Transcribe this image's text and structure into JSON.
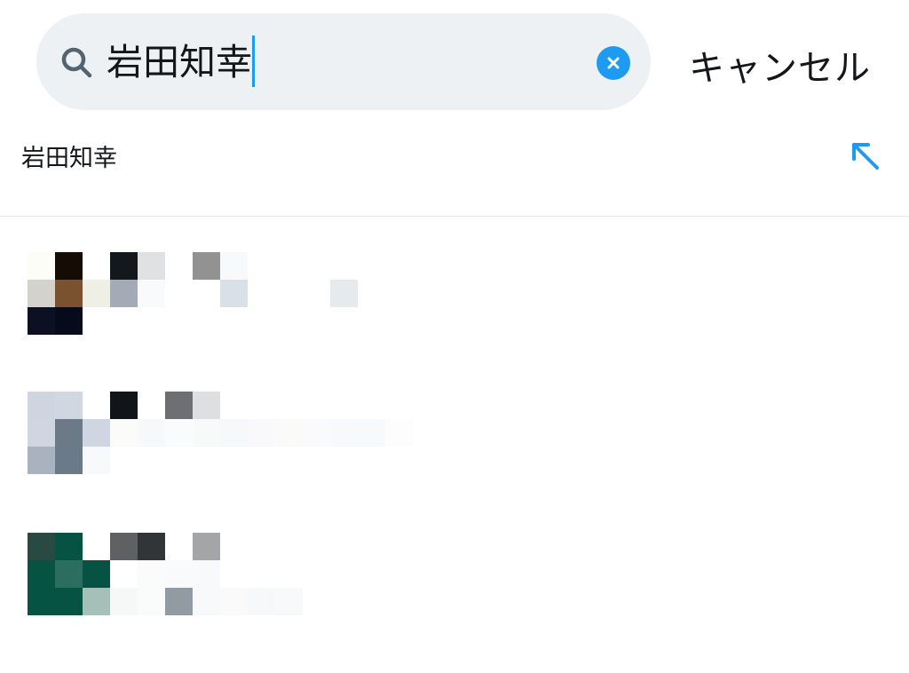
{
  "search": {
    "query": "岩田知幸",
    "icon": "search-icon",
    "clear_icon": "clear-icon"
  },
  "cancel_label": "キャンセル",
  "suggestion": {
    "text": "岩田知幸",
    "icon": "fill-query-arrow-icon"
  },
  "results": [
    {
      "pixels": [
        [
          "#fdfdf8",
          0,
          0
        ],
        [
          "#160c06",
          1,
          0
        ],
        [
          "#14171c",
          3,
          0
        ],
        [
          "#e0e1e3",
          4,
          0
        ],
        [
          "#929293",
          6,
          0
        ],
        [
          "#f8f9fa",
          7,
          0
        ],
        [
          "#d4d2cc",
          0,
          1
        ],
        [
          "#7a5231",
          1,
          1
        ],
        [
          "#f0efe6",
          2,
          1
        ],
        [
          "#a3abb6",
          3,
          1
        ],
        [
          "#f9fafb",
          4,
          1
        ],
        [
          "#d9e0e7",
          7,
          1
        ],
        [
          "#e7eaed",
          11,
          1
        ],
        [
          "#0b1023",
          0,
          2
        ],
        [
          "#070a1a",
          1,
          2
        ]
      ]
    },
    {
      "pixels": [
        [
          "#ced5e0",
          0,
          0
        ],
        [
          "#d0d7e1",
          1,
          0
        ],
        [
          "#111517",
          3,
          0
        ],
        [
          "#6d6f73",
          5,
          0
        ],
        [
          "#dedfe1",
          6,
          0
        ],
        [
          "#cfd6e1",
          0,
          1
        ],
        [
          "#6c7a88",
          1,
          1
        ],
        [
          "#cfd6e1",
          2,
          1
        ],
        [
          "#fbfbf9",
          3,
          1
        ],
        [
          "#f7f8fa",
          4,
          1
        ],
        [
          "#fafbfc",
          5,
          1
        ],
        [
          "#f8fafa",
          6,
          1
        ],
        [
          "#f7f8fa",
          7,
          1
        ],
        [
          "#f9f9fb",
          8,
          1
        ],
        [
          "#fafbf9",
          9,
          1
        ],
        [
          "#fafafc",
          10,
          1
        ],
        [
          "#f8f9fb",
          11,
          1
        ],
        [
          "#f8f9fa",
          12,
          1
        ],
        [
          "#fdfdfd",
          13,
          1
        ],
        [
          "#a9b3bf",
          0,
          2
        ],
        [
          "#6b7a89",
          1,
          2
        ],
        [
          "#f8f9fb",
          2,
          2
        ]
      ]
    },
    {
      "pixels": [
        [
          "#284a43",
          0,
          0
        ],
        [
          "#075343",
          1,
          0
        ],
        [
          "#5f6062",
          3,
          0
        ],
        [
          "#323538",
          4,
          0
        ],
        [
          "#a4a5a7",
          6,
          0
        ],
        [
          "#075343",
          0,
          1
        ],
        [
          "#2b6d5f",
          1,
          1
        ],
        [
          "#075343",
          2,
          1
        ],
        [
          "#fbfbfb",
          4,
          1
        ],
        [
          "#f9fafb",
          5,
          1
        ],
        [
          "#f8f9fa",
          6,
          1
        ],
        [
          "#075343",
          0,
          2
        ],
        [
          "#075343",
          1,
          2
        ],
        [
          "#a4c0b8",
          2,
          2
        ],
        [
          "#f6f8f7",
          3,
          2
        ],
        [
          "#fafbfb",
          4,
          2
        ],
        [
          "#929aa2",
          5,
          2
        ],
        [
          "#f8f9fa",
          6,
          2
        ],
        [
          "#fafafa",
          7,
          2
        ],
        [
          "#f7f8f9",
          8,
          2
        ],
        [
          "#f8f9fa",
          9,
          2
        ]
      ]
    }
  ],
  "colors": {
    "accent": "#1d9bf0",
    "search_bg": "#edf1f4",
    "text": "#14171a",
    "icon_gray": "#536471"
  }
}
